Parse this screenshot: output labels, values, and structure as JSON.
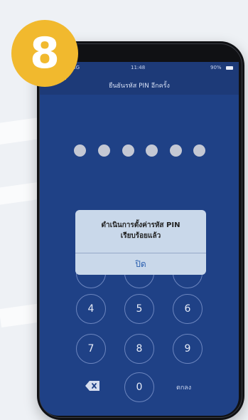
{
  "step_badge": "8",
  "status_bar": {
    "carrier": "ll 4G",
    "time": "11:48",
    "battery": "90%"
  },
  "header": {
    "title": "ยืนยันรหัส PIN อีกครั้ง"
  },
  "pin": {
    "length": 6,
    "filled": 6
  },
  "keypad": {
    "row2": [
      "4",
      "5",
      "6"
    ],
    "row3": [
      "7",
      "8",
      "9"
    ],
    "zero": "0",
    "ok_label": "ตกลง"
  },
  "dialog": {
    "line1": "ดำเนินการตั้งค่ารหัส PIN",
    "line2": "เรียบร้อยแล้ว",
    "button": "ปิด"
  },
  "colors": {
    "screen_bg": "#1f4186",
    "badge": "#f1b92e",
    "dialog_bg": "#c9d8ea"
  }
}
